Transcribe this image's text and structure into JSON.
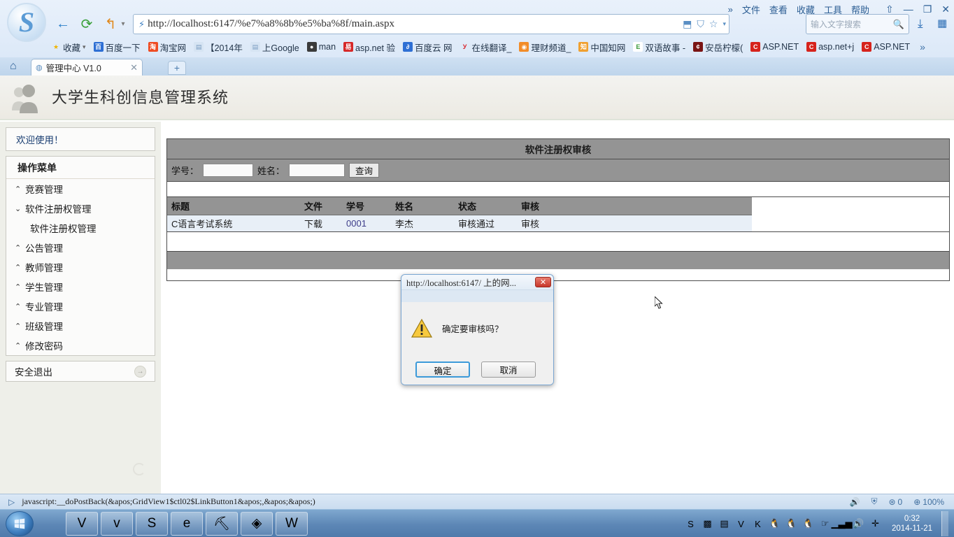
{
  "browser": {
    "window_menu": [
      "文件",
      "查看",
      "收藏",
      "工具",
      "帮助"
    ],
    "overflow_chevron": "»",
    "window_controls": {
      "restore_skin": "⇧",
      "minimize": "—",
      "maximize": "❐",
      "close": "✕"
    },
    "nav": {
      "back": "←",
      "reload": "⟳",
      "home": "↰",
      "dropdown": "▾"
    },
    "address": {
      "lightning": "⚡",
      "url": "http://localhost:6147/%e7%a8%8b%e5%ba%8f/main.aspx",
      "icons": [
        "save-page-icon",
        "shield-icon",
        "favorite-star-icon",
        "star-dropdown-icon"
      ]
    },
    "search": {
      "placeholder": "输入文字搜索",
      "icon": "search-icon"
    },
    "download_icon": "⤓",
    "apps_icon": "▦",
    "bookmarks": [
      {
        "label": "收藏",
        "icon": "★",
        "icon_bg": "transparent",
        "icon_color": "#f0b400",
        "caret": "▾"
      },
      {
        "label": "百度一下",
        "icon": "百",
        "icon_bg": "#2e6fd4"
      },
      {
        "label": "淘宝网",
        "icon": "淘",
        "icon_bg": "#ef4b22"
      },
      {
        "label": "【2014年",
        "icon": "▤",
        "icon_bg": "#d6e4f3",
        "icon_color": "#7a9cc0"
      },
      {
        "label": "上Google",
        "icon": "▤",
        "icon_bg": "#d6e4f3",
        "icon_color": "#7a9cc0"
      },
      {
        "label": "man",
        "icon": "●",
        "icon_bg": "#3b3b3b"
      },
      {
        "label": "asp.net 验",
        "icon": "易",
        "icon_bg": "#d62828"
      },
      {
        "label": "百度云 网",
        "icon": "∂",
        "icon_bg": "#2e6fd4"
      },
      {
        "label": "在线翻译_",
        "icon": "У",
        "icon_bg": "transparent",
        "icon_color": "#d8232a"
      },
      {
        "label": "理财频道_",
        "icon": "◉",
        "icon_bg": "#f28c28"
      },
      {
        "label": "中国知网",
        "icon": "知",
        "icon_bg": "#f0a030"
      },
      {
        "label": "双语故事 -",
        "icon": "E",
        "icon_bg": "#ffffff",
        "icon_color": "#3a9a3a"
      },
      {
        "label": "安岳柠檬(",
        "icon": "¢",
        "icon_bg": "#7a1414"
      },
      {
        "label": "ASP.NET",
        "icon": "C",
        "icon_bg": "#d6231c"
      },
      {
        "label": "asp.net+j",
        "icon": "C",
        "icon_bg": "#d6231c"
      },
      {
        "label": "ASP.NET",
        "icon": "C",
        "icon_bg": "#d6231c"
      }
    ],
    "bookmarks_more": "»",
    "home_tab_icon": "⌂",
    "tab": {
      "label": "管理中心 V1.0",
      "favicon": "◍",
      "close": "✕"
    },
    "new_tab": "+"
  },
  "site": {
    "title": "大学生科创信息管理系统",
    "avatar_icon": "user-group-icon"
  },
  "sidebar": {
    "welcome": "欢迎使用！",
    "menu_title": "操作菜单",
    "items": [
      {
        "label": "竞赛管理",
        "chevron": "⌃",
        "expanded": false
      },
      {
        "label": "软件注册权管理",
        "chevron": "⌄",
        "expanded": true
      },
      {
        "label": "公告管理",
        "chevron": "⌃",
        "expanded": false
      },
      {
        "label": "教师管理",
        "chevron": "⌃",
        "expanded": false
      },
      {
        "label": "学生管理",
        "chevron": "⌃",
        "expanded": false
      },
      {
        "label": "专业管理",
        "chevron": "⌃",
        "expanded": false
      },
      {
        "label": "班级管理",
        "chevron": "⌃",
        "expanded": false
      },
      {
        "label": "修改密码",
        "chevron": "⌃",
        "expanded": false
      }
    ],
    "submenu_label": "软件注册权管理",
    "logout": {
      "label": "安全退出",
      "arrow": "→"
    }
  },
  "content": {
    "title": "软件注册权审核",
    "search": {
      "student_id_label": "学号：",
      "student_id_value": "",
      "name_label": "姓名：",
      "name_value": "",
      "query_button": "查询"
    },
    "table": {
      "columns": [
        "标题",
        "文件",
        "学号",
        "姓名",
        "状态",
        "审核"
      ],
      "rows": [
        {
          "标题": "C语言考试系统",
          "文件": "下载",
          "学号": "0001",
          "姓名": "李杰",
          "状态": "审核通过",
          "审核": "审核"
        }
      ]
    }
  },
  "dialog": {
    "title": "http://localhost:6147/ 上的网...",
    "close_icon": "✕",
    "warning_icon": "warning-triangle-icon",
    "message": "确定要审核吗？",
    "ok_button": "确定",
    "cancel_button": "取消"
  },
  "statusbar": {
    "icon": "▷",
    "text": "javascript:__doPostBack(&apos;GridView1$ctl02$LinkButton1&apos;,&apos;&apos;)",
    "volume_icon": "🔊",
    "toolbox_icon": "⛨",
    "ad_block_icon": "AD",
    "ad_block_count": "0",
    "zoom_icon": "⊕",
    "zoom_level": "100%"
  },
  "taskbar": {
    "start_icon": "windows-orb-icon",
    "apps": [
      {
        "name": "visio-taskbar-button",
        "glyph": "V"
      },
      {
        "name": "vov-taskbar-button",
        "glyph": "v"
      },
      {
        "name": "sogou-browser-taskbar-button",
        "glyph": "S"
      },
      {
        "name": "internet-explorer-taskbar-button",
        "glyph": "e"
      },
      {
        "name": "devtools-taskbar-button",
        "glyph": "⛏"
      },
      {
        "name": "media-taskbar-button",
        "glyph": "◈"
      },
      {
        "name": "word-taskbar-button",
        "glyph": "W"
      }
    ],
    "tray": [
      {
        "name": "sogou-input-tray-icon",
        "glyph": "S"
      },
      {
        "name": "colorful-tray-icon",
        "glyph": "▩"
      },
      {
        "name": "note-tray-icon",
        "glyph": "▤"
      },
      {
        "name": "vov-tray-icon",
        "glyph": "V"
      },
      {
        "name": "kingsoft-tray-icon",
        "glyph": "K"
      },
      {
        "name": "qq-tray-icon-1",
        "glyph": "🐧"
      },
      {
        "name": "qq-tray-icon-2",
        "glyph": "🐧"
      },
      {
        "name": "qq-tray-icon-3",
        "glyph": "🐧"
      },
      {
        "name": "hand-tray-icon",
        "glyph": "☞"
      },
      {
        "name": "network-tray-icon",
        "glyph": "▁▃▅"
      },
      {
        "name": "volume-tray-icon",
        "glyph": "🔊"
      },
      {
        "name": "plus-tray-icon",
        "glyph": "✛"
      }
    ],
    "clock_time": "0:32",
    "clock_date": "2014-11-21"
  },
  "colors": {
    "accent_blue": "#2b6eb5",
    "panel_gray": "#949494",
    "row_blue": "#e8eff7",
    "sidebar_bg": "#eeefe9",
    "taskbar_blue": "#5d87b6"
  }
}
